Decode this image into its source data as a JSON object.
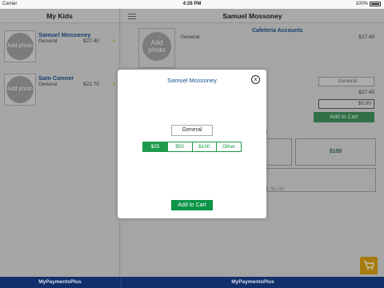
{
  "status_bar": {
    "carrier": "Carrier",
    "time": "4:26 PM",
    "battery": "100%"
  },
  "sidebar": {
    "title": "My Kids",
    "kids": [
      {
        "photo_label": "Add photo",
        "name": "Samuel Mossoney",
        "plan": "General",
        "amount": "$27.40"
      },
      {
        "photo_label": "Add photo",
        "name": "Sam Conner",
        "plan": "General",
        "amount": "$22.70"
      }
    ]
  },
  "main": {
    "title": "Samuel Mossoney",
    "photo_label": "Add photo",
    "section_title": "Cafeteria Accounts",
    "plan": "General",
    "amount": "$27.40",
    "field_plan": "General",
    "balance": "$27.40",
    "field_amount": "$0.00",
    "add_to_cart": "Add to Cart",
    "section_fragment": "o",
    "box_amount": "$100",
    "total_fragment": "t: $0.00"
  },
  "modal": {
    "title": "Samuel Mossoney",
    "plan_value": "General",
    "amount_options": [
      "$25",
      "$50",
      "$100",
      "Other"
    ],
    "selected_option": "$25",
    "add_to_cart": "Add to Cart"
  },
  "footer": {
    "left": "MyPaymentsPlus",
    "right": "MyPaymentsPlus"
  },
  "colors": {
    "brand_green": "#0b9446",
    "navy": "#102f6b",
    "link_blue": "#1a4f8a",
    "cart_gold": "#d09a10"
  },
  "icons": {
    "menu": "hamburger-menu-icon",
    "close": "close-circle-icon",
    "cart": "shopping-cart-icon",
    "chevron": "chevron-right-icon"
  }
}
